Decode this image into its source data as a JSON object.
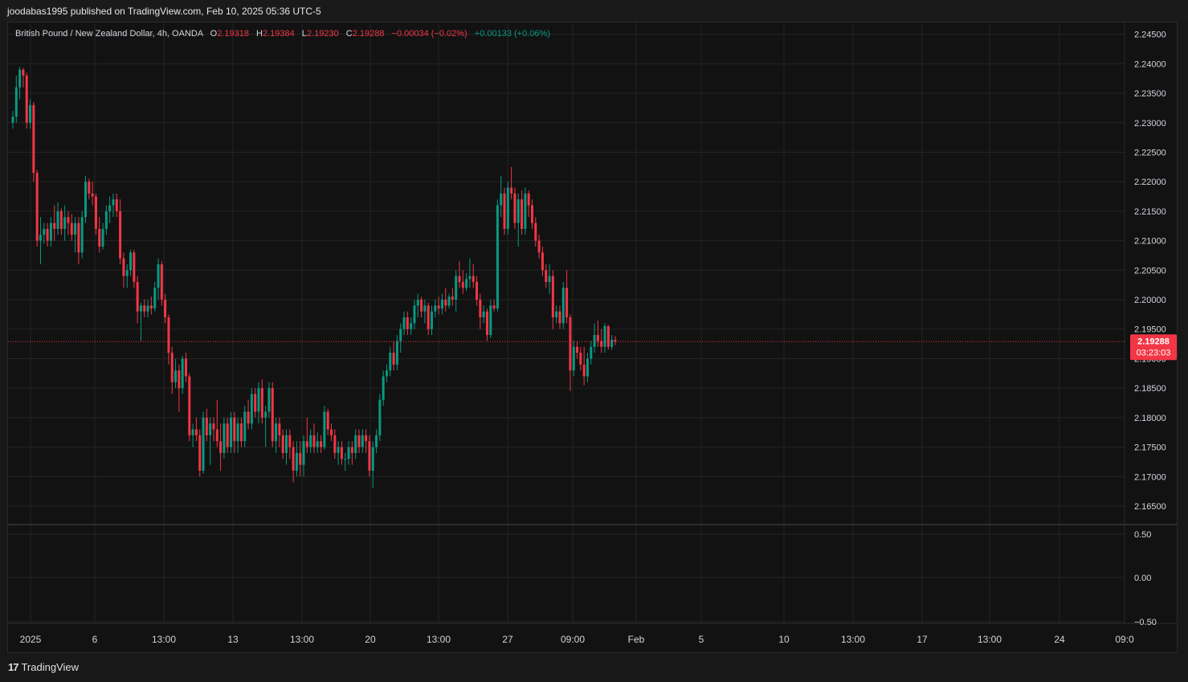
{
  "header": {
    "published": "joodabas1995 published on TradingView.com, Feb 10, 2025 05:36 UTC-5"
  },
  "legend": {
    "symbol": "British Pound / New Zealand Dollar, 4h, OANDA",
    "o_label": "O",
    "o": "2.19318",
    "h_label": "H",
    "h": "2.19384",
    "l_label": "L",
    "l": "2.19230",
    "c_label": "C",
    "c": "2.19288",
    "change": "−0.00034 (−0.02%)",
    "change2": "+0.00133 (+0.06%)"
  },
  "price_tag": {
    "price": "2.19288",
    "countdown": "03:23:03"
  },
  "footer": {
    "logo_text": "TradingView"
  },
  "colors": {
    "up": "#089981",
    "down": "#f23645",
    "grid": "#242424",
    "bg": "#121212"
  },
  "chart_data": {
    "type": "candlestick",
    "title": "British Pound / New Zealand Dollar, 4h, OANDA",
    "ylim": [
      2.162,
      2.247
    ],
    "y_ticks": [
      "2.24500",
      "2.24000",
      "2.23500",
      "2.23000",
      "2.22500",
      "2.22000",
      "2.21500",
      "2.21000",
      "2.20500",
      "2.20000",
      "2.19500",
      "2.19000",
      "2.18500",
      "2.18000",
      "2.17500",
      "2.17000",
      "2.16500"
    ],
    "last_price": 2.19288,
    "x_ticks": [
      "2025",
      "6",
      "13:00",
      "13",
      "13:00",
      "20",
      "13:00",
      "27",
      "09:00",
      "Feb",
      "5",
      "10",
      "13:00",
      "17",
      "13:00",
      "24",
      "09:0"
    ],
    "oscillator": {
      "y_ticks": [
        "0.50",
        "0.00",
        "−0.50"
      ]
    },
    "series": [
      {
        "o": 2.23,
        "h": 2.232,
        "l": 2.229,
        "c": 2.231
      },
      {
        "o": 2.231,
        "h": 2.238,
        "l": 2.23,
        "c": 2.236
      },
      {
        "o": 2.236,
        "h": 2.2395,
        "l": 2.234,
        "c": 2.239
      },
      {
        "o": 2.239,
        "h": 2.2393,
        "l": 2.236,
        "c": 2.238
      },
      {
        "o": 2.238,
        "h": 2.2385,
        "l": 2.229,
        "c": 2.23
      },
      {
        "o": 2.23,
        "h": 2.234,
        "l": 2.229,
        "c": 2.233
      },
      {
        "o": 2.233,
        "h": 2.2335,
        "l": 2.22,
        "c": 2.2215
      },
      {
        "o": 2.2215,
        "h": 2.222,
        "l": 2.209,
        "c": 2.21
      },
      {
        "o": 2.21,
        "h": 2.214,
        "l": 2.206,
        "c": 2.211
      },
      {
        "o": 2.211,
        "h": 2.213,
        "l": 2.2095,
        "c": 2.212
      },
      {
        "o": 2.212,
        "h": 2.213,
        "l": 2.209,
        "c": 2.21
      },
      {
        "o": 2.21,
        "h": 2.214,
        "l": 2.209,
        "c": 2.213
      },
      {
        "o": 2.213,
        "h": 2.216,
        "l": 2.21,
        "c": 2.212
      },
      {
        "o": 2.212,
        "h": 2.2165,
        "l": 2.211,
        "c": 2.215
      },
      {
        "o": 2.215,
        "h": 2.2155,
        "l": 2.211,
        "c": 2.212
      },
      {
        "o": 2.212,
        "h": 2.216,
        "l": 2.21,
        "c": 2.214
      },
      {
        "o": 2.214,
        "h": 2.215,
        "l": 2.211,
        "c": 2.213
      },
      {
        "o": 2.213,
        "h": 2.2145,
        "l": 2.21,
        "c": 2.211
      },
      {
        "o": 2.211,
        "h": 2.214,
        "l": 2.208,
        "c": 2.213
      },
      {
        "o": 2.213,
        "h": 2.214,
        "l": 2.206,
        "c": 2.208
      },
      {
        "o": 2.208,
        "h": 2.215,
        "l": 2.207,
        "c": 2.214
      },
      {
        "o": 2.214,
        "h": 2.221,
        "l": 2.213,
        "c": 2.22
      },
      {
        "o": 2.22,
        "h": 2.2205,
        "l": 2.217,
        "c": 2.218
      },
      {
        "o": 2.218,
        "h": 2.22,
        "l": 2.216,
        "c": 2.2175
      },
      {
        "o": 2.2175,
        "h": 2.218,
        "l": 2.211,
        "c": 2.212
      },
      {
        "o": 2.212,
        "h": 2.214,
        "l": 2.208,
        "c": 2.209
      },
      {
        "o": 2.209,
        "h": 2.213,
        "l": 2.2085,
        "c": 2.212
      },
      {
        "o": 2.212,
        "h": 2.216,
        "l": 2.211,
        "c": 2.215
      },
      {
        "o": 2.215,
        "h": 2.2175,
        "l": 2.213,
        "c": 2.216
      },
      {
        "o": 2.216,
        "h": 2.218,
        "l": 2.214,
        "c": 2.217
      },
      {
        "o": 2.217,
        "h": 2.218,
        "l": 2.214,
        "c": 2.215
      },
      {
        "o": 2.215,
        "h": 2.217,
        "l": 2.206,
        "c": 2.207
      },
      {
        "o": 2.207,
        "h": 2.208,
        "l": 2.202,
        "c": 2.204
      },
      {
        "o": 2.204,
        "h": 2.206,
        "l": 2.202,
        "c": 2.205
      },
      {
        "o": 2.205,
        "h": 2.2085,
        "l": 2.204,
        "c": 2.208
      },
      {
        "o": 2.208,
        "h": 2.2085,
        "l": 2.202,
        "c": 2.203
      },
      {
        "o": 2.203,
        "h": 2.204,
        "l": 2.196,
        "c": 2.198
      },
      {
        "o": 2.198,
        "h": 2.1995,
        "l": 2.193,
        "c": 2.199
      },
      {
        "o": 2.199,
        "h": 2.2,
        "l": 2.197,
        "c": 2.198
      },
      {
        "o": 2.198,
        "h": 2.2,
        "l": 2.197,
        "c": 2.199
      },
      {
        "o": 2.199,
        "h": 2.2005,
        "l": 2.1975,
        "c": 2.1985
      },
      {
        "o": 2.1985,
        "h": 2.203,
        "l": 2.198,
        "c": 2.202
      },
      {
        "o": 2.202,
        "h": 2.207,
        "l": 2.2,
        "c": 2.206
      },
      {
        "o": 2.206,
        "h": 2.2065,
        "l": 2.199,
        "c": 2.2
      },
      {
        "o": 2.2,
        "h": 2.201,
        "l": 2.196,
        "c": 2.197
      },
      {
        "o": 2.197,
        "h": 2.1975,
        "l": 2.189,
        "c": 2.191
      },
      {
        "o": 2.191,
        "h": 2.192,
        "l": 2.184,
        "c": 2.186
      },
      {
        "o": 2.186,
        "h": 2.19,
        "l": 2.185,
        "c": 2.188
      },
      {
        "o": 2.188,
        "h": 2.189,
        "l": 2.181,
        "c": 2.185
      },
      {
        "o": 2.185,
        "h": 2.1905,
        "l": 2.184,
        "c": 2.19
      },
      {
        "o": 2.19,
        "h": 2.191,
        "l": 2.186,
        "c": 2.187
      },
      {
        "o": 2.187,
        "h": 2.1875,
        "l": 2.176,
        "c": 2.177
      },
      {
        "o": 2.177,
        "h": 2.179,
        "l": 2.175,
        "c": 2.178
      },
      {
        "o": 2.178,
        "h": 2.18,
        "l": 2.176,
        "c": 2.177
      },
      {
        "o": 2.177,
        "h": 2.178,
        "l": 2.17,
        "c": 2.171
      },
      {
        "o": 2.171,
        "h": 2.181,
        "l": 2.1705,
        "c": 2.18
      },
      {
        "o": 2.18,
        "h": 2.1815,
        "l": 2.176,
        "c": 2.177
      },
      {
        "o": 2.177,
        "h": 2.18,
        "l": 2.172,
        "c": 2.179
      },
      {
        "o": 2.179,
        "h": 2.18,
        "l": 2.176,
        "c": 2.178
      },
      {
        "o": 2.178,
        "h": 2.183,
        "l": 2.175,
        "c": 2.176
      },
      {
        "o": 2.176,
        "h": 2.179,
        "l": 2.171,
        "c": 2.174
      },
      {
        "o": 2.174,
        "h": 2.18,
        "l": 2.173,
        "c": 2.179
      },
      {
        "o": 2.179,
        "h": 2.18,
        "l": 2.174,
        "c": 2.175
      },
      {
        "o": 2.175,
        "h": 2.181,
        "l": 2.174,
        "c": 2.18
      },
      {
        "o": 2.18,
        "h": 2.181,
        "l": 2.174,
        "c": 2.176
      },
      {
        "o": 2.176,
        "h": 2.18,
        "l": 2.174,
        "c": 2.179
      },
      {
        "o": 2.179,
        "h": 2.18,
        "l": 2.175,
        "c": 2.176
      },
      {
        "o": 2.176,
        "h": 2.182,
        "l": 2.175,
        "c": 2.181
      },
      {
        "o": 2.181,
        "h": 2.183,
        "l": 2.178,
        "c": 2.179
      },
      {
        "o": 2.179,
        "h": 2.185,
        "l": 2.178,
        "c": 2.184
      },
      {
        "o": 2.184,
        "h": 2.185,
        "l": 2.18,
        "c": 2.181
      },
      {
        "o": 2.181,
        "h": 2.186,
        "l": 2.179,
        "c": 2.185
      },
      {
        "o": 2.185,
        "h": 2.1865,
        "l": 2.179,
        "c": 2.18
      },
      {
        "o": 2.18,
        "h": 2.182,
        "l": 2.175,
        "c": 2.181
      },
      {
        "o": 2.181,
        "h": 2.186,
        "l": 2.18,
        "c": 2.185
      },
      {
        "o": 2.185,
        "h": 2.186,
        "l": 2.175,
        "c": 2.176
      },
      {
        "o": 2.176,
        "h": 2.18,
        "l": 2.174,
        "c": 2.179
      },
      {
        "o": 2.179,
        "h": 2.18,
        "l": 2.175,
        "c": 2.177
      },
      {
        "o": 2.177,
        "h": 2.178,
        "l": 2.173,
        "c": 2.174
      },
      {
        "o": 2.174,
        "h": 2.178,
        "l": 2.172,
        "c": 2.177
      },
      {
        "o": 2.177,
        "h": 2.178,
        "l": 2.173,
        "c": 2.175
      },
      {
        "o": 2.175,
        "h": 2.176,
        "l": 2.169,
        "c": 2.171
      },
      {
        "o": 2.171,
        "h": 2.176,
        "l": 2.17,
        "c": 2.174
      },
      {
        "o": 2.174,
        "h": 2.176,
        "l": 2.17,
        "c": 2.172
      },
      {
        "o": 2.172,
        "h": 2.177,
        "l": 2.17,
        "c": 2.176
      },
      {
        "o": 2.176,
        "h": 2.18,
        "l": 2.174,
        "c": 2.175
      },
      {
        "o": 2.175,
        "h": 2.178,
        "l": 2.174,
        "c": 2.177
      },
      {
        "o": 2.177,
        "h": 2.179,
        "l": 2.174,
        "c": 2.175
      },
      {
        "o": 2.175,
        "h": 2.1775,
        "l": 2.174,
        "c": 2.176
      },
      {
        "o": 2.176,
        "h": 2.177,
        "l": 2.174,
        "c": 2.175
      },
      {
        "o": 2.175,
        "h": 2.182,
        "l": 2.1745,
        "c": 2.181
      },
      {
        "o": 2.181,
        "h": 2.1815,
        "l": 2.177,
        "c": 2.178
      },
      {
        "o": 2.178,
        "h": 2.179,
        "l": 2.176,
        "c": 2.177
      },
      {
        "o": 2.177,
        "h": 2.178,
        "l": 2.173,
        "c": 2.174
      },
      {
        "o": 2.174,
        "h": 2.176,
        "l": 2.172,
        "c": 2.175
      },
      {
        "o": 2.175,
        "h": 2.176,
        "l": 2.172,
        "c": 2.173
      },
      {
        "o": 2.173,
        "h": 2.174,
        "l": 2.171,
        "c": 2.173
      },
      {
        "o": 2.173,
        "h": 2.176,
        "l": 2.172,
        "c": 2.175
      },
      {
        "o": 2.175,
        "h": 2.176,
        "l": 2.172,
        "c": 2.174
      },
      {
        "o": 2.174,
        "h": 2.178,
        "l": 2.173,
        "c": 2.177
      },
      {
        "o": 2.177,
        "h": 2.178,
        "l": 2.174,
        "c": 2.175
      },
      {
        "o": 2.175,
        "h": 2.178,
        "l": 2.174,
        "c": 2.177
      },
      {
        "o": 2.177,
        "h": 2.178,
        "l": 2.174,
        "c": 2.176
      },
      {
        "o": 2.176,
        "h": 2.177,
        "l": 2.17,
        "c": 2.171
      },
      {
        "o": 2.171,
        "h": 2.176,
        "l": 2.168,
        "c": 2.175
      },
      {
        "o": 2.175,
        "h": 2.178,
        "l": 2.174,
        "c": 2.177
      },
      {
        "o": 2.177,
        "h": 2.184,
        "l": 2.176,
        "c": 2.183
      },
      {
        "o": 2.183,
        "h": 2.188,
        "l": 2.182,
        "c": 2.187
      },
      {
        "o": 2.187,
        "h": 2.189,
        "l": 2.186,
        "c": 2.188
      },
      {
        "o": 2.188,
        "h": 2.192,
        "l": 2.187,
        "c": 2.191
      },
      {
        "o": 2.191,
        "h": 2.193,
        "l": 2.188,
        "c": 2.189
      },
      {
        "o": 2.189,
        "h": 2.194,
        "l": 2.188,
        "c": 2.193
      },
      {
        "o": 2.193,
        "h": 2.196,
        "l": 2.191,
        "c": 2.195
      },
      {
        "o": 2.195,
        "h": 2.198,
        "l": 2.194,
        "c": 2.197
      },
      {
        "o": 2.197,
        "h": 2.198,
        "l": 2.194,
        "c": 2.195
      },
      {
        "o": 2.195,
        "h": 2.197,
        "l": 2.194,
        "c": 2.196
      },
      {
        "o": 2.196,
        "h": 2.2,
        "l": 2.195,
        "c": 2.199
      },
      {
        "o": 2.199,
        "h": 2.201,
        "l": 2.197,
        "c": 2.2
      },
      {
        "o": 2.2,
        "h": 2.2005,
        "l": 2.197,
        "c": 2.198
      },
      {
        "o": 2.198,
        "h": 2.2,
        "l": 2.196,
        "c": 2.199
      },
      {
        "o": 2.199,
        "h": 2.1995,
        "l": 2.194,
        "c": 2.195
      },
      {
        "o": 2.195,
        "h": 2.199,
        "l": 2.194,
        "c": 2.198
      },
      {
        "o": 2.198,
        "h": 2.2,
        "l": 2.197,
        "c": 2.199
      },
      {
        "o": 2.199,
        "h": 2.2005,
        "l": 2.1975,
        "c": 2.1985
      },
      {
        "o": 2.1985,
        "h": 2.201,
        "l": 2.1975,
        "c": 2.2
      },
      {
        "o": 2.2,
        "h": 2.202,
        "l": 2.198,
        "c": 2.199
      },
      {
        "o": 2.199,
        "h": 2.201,
        "l": 2.1985,
        "c": 2.2005
      },
      {
        "o": 2.2005,
        "h": 2.202,
        "l": 2.199,
        "c": 2.2
      },
      {
        "o": 2.2,
        "h": 2.205,
        "l": 2.198,
        "c": 2.204
      },
      {
        "o": 2.204,
        "h": 2.2065,
        "l": 2.202,
        "c": 2.203
      },
      {
        "o": 2.203,
        "h": 2.205,
        "l": 2.201,
        "c": 2.202
      },
      {
        "o": 2.202,
        "h": 2.2045,
        "l": 2.2015,
        "c": 2.2035
      },
      {
        "o": 2.2035,
        "h": 2.207,
        "l": 2.202,
        "c": 2.204
      },
      {
        "o": 2.204,
        "h": 2.206,
        "l": 2.202,
        "c": 2.203
      },
      {
        "o": 2.203,
        "h": 2.204,
        "l": 2.199,
        "c": 2.2
      },
      {
        "o": 2.2,
        "h": 2.201,
        "l": 2.195,
        "c": 2.197
      },
      {
        "o": 2.197,
        "h": 2.199,
        "l": 2.196,
        "c": 2.198
      },
      {
        "o": 2.198,
        "h": 2.1985,
        "l": 2.193,
        "c": 2.194
      },
      {
        "o": 2.194,
        "h": 2.2,
        "l": 2.1935,
        "c": 2.199
      },
      {
        "o": 2.199,
        "h": 2.2,
        "l": 2.198,
        "c": 2.1985
      },
      {
        "o": 2.1985,
        "h": 2.217,
        "l": 2.198,
        "c": 2.216
      },
      {
        "o": 2.216,
        "h": 2.221,
        "l": 2.214,
        "c": 2.218
      },
      {
        "o": 2.218,
        "h": 2.219,
        "l": 2.211,
        "c": 2.212
      },
      {
        "o": 2.212,
        "h": 2.22,
        "l": 2.211,
        "c": 2.219
      },
      {
        "o": 2.219,
        "h": 2.2225,
        "l": 2.217,
        "c": 2.218
      },
      {
        "o": 2.218,
        "h": 2.219,
        "l": 2.212,
        "c": 2.213
      },
      {
        "o": 2.213,
        "h": 2.218,
        "l": 2.209,
        "c": 2.217
      },
      {
        "o": 2.217,
        "h": 2.2185,
        "l": 2.211,
        "c": 2.212
      },
      {
        "o": 2.212,
        "h": 2.219,
        "l": 2.211,
        "c": 2.218
      },
      {
        "o": 2.218,
        "h": 2.2185,
        "l": 2.214,
        "c": 2.216
      },
      {
        "o": 2.216,
        "h": 2.217,
        "l": 2.212,
        "c": 2.213
      },
      {
        "o": 2.213,
        "h": 2.214,
        "l": 2.209,
        "c": 2.21
      },
      {
        "o": 2.21,
        "h": 2.211,
        "l": 2.207,
        "c": 2.208
      },
      {
        "o": 2.208,
        "h": 2.209,
        "l": 2.204,
        "c": 2.205
      },
      {
        "o": 2.205,
        "h": 2.206,
        "l": 2.202,
        "c": 2.203
      },
      {
        "o": 2.203,
        "h": 2.206,
        "l": 2.201,
        "c": 2.204
      },
      {
        "o": 2.204,
        "h": 2.205,
        "l": 2.195,
        "c": 2.197
      },
      {
        "o": 2.197,
        "h": 2.199,
        "l": 2.196,
        "c": 2.198
      },
      {
        "o": 2.198,
        "h": 2.199,
        "l": 2.195,
        "c": 2.196
      },
      {
        "o": 2.196,
        "h": 2.203,
        "l": 2.195,
        "c": 2.202
      },
      {
        "o": 2.202,
        "h": 2.205,
        "l": 2.196,
        "c": 2.197
      },
      {
        "o": 2.197,
        "h": 2.1975,
        "l": 2.1845,
        "c": 2.188
      },
      {
        "o": 2.188,
        "h": 2.193,
        "l": 2.187,
        "c": 2.192
      },
      {
        "o": 2.192,
        "h": 2.193,
        "l": 2.19,
        "c": 2.191
      },
      {
        "o": 2.191,
        "h": 2.192,
        "l": 2.188,
        "c": 2.189
      },
      {
        "o": 2.189,
        "h": 2.192,
        "l": 2.1855,
        "c": 2.187
      },
      {
        "o": 2.187,
        "h": 2.191,
        "l": 2.186,
        "c": 2.19
      },
      {
        "o": 2.19,
        "h": 2.193,
        "l": 2.189,
        "c": 2.192
      },
      {
        "o": 2.192,
        "h": 2.196,
        "l": 2.191,
        "c": 2.194
      },
      {
        "o": 2.194,
        "h": 2.1965,
        "l": 2.192,
        "c": 2.193
      },
      {
        "o": 2.193,
        "h": 2.195,
        "l": 2.191,
        "c": 2.192
      },
      {
        "o": 2.192,
        "h": 2.196,
        "l": 2.191,
        "c": 2.1955
      },
      {
        "o": 2.1955,
        "h": 2.1957,
        "l": 2.1915,
        "c": 2.192
      },
      {
        "o": 2.192,
        "h": 2.194,
        "l": 2.1915,
        "c": 2.1932
      },
      {
        "o": 2.19318,
        "h": 2.19384,
        "l": 2.1923,
        "c": 2.19288
      }
    ]
  }
}
